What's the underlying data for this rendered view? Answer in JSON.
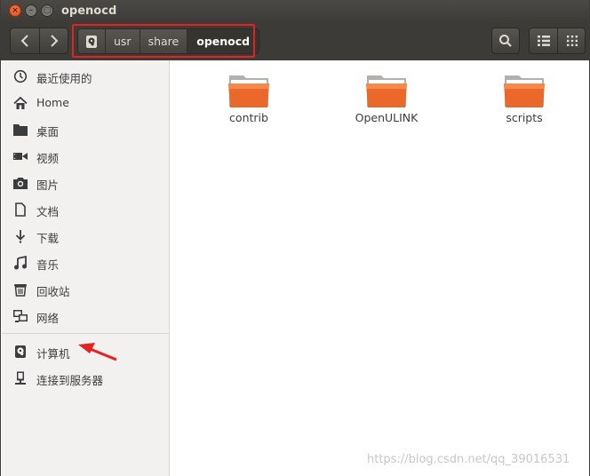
{
  "window": {
    "title": "openocd"
  },
  "titlebar": {
    "close": "×",
    "minimize": "–",
    "maximize": "□"
  },
  "breadcrumbs": [
    {
      "label": "",
      "icon": "disk-icon"
    },
    {
      "label": "usr"
    },
    {
      "label": "share"
    },
    {
      "label": "openocd",
      "active": true
    }
  ],
  "sidebar": {
    "items": [
      {
        "label": "最近使用的",
        "icon": "clock-icon"
      },
      {
        "label": "Home",
        "icon": "home-icon"
      },
      {
        "label": "桌面",
        "icon": "folder-icon"
      },
      {
        "label": "视频",
        "icon": "video-icon"
      },
      {
        "label": "图片",
        "icon": "camera-icon"
      },
      {
        "label": "文档",
        "icon": "document-icon"
      },
      {
        "label": "下载",
        "icon": "download-icon"
      },
      {
        "label": "音乐",
        "icon": "music-icon"
      },
      {
        "label": "回收站",
        "icon": "trash-icon"
      },
      {
        "label": "网络",
        "icon": "network-icon"
      }
    ],
    "devices": [
      {
        "label": "计算机",
        "icon": "disk-icon"
      },
      {
        "label": "连接到服务器",
        "icon": "server-icon"
      }
    ]
  },
  "files": [
    {
      "name": "contrib",
      "icon": "folder-icon"
    },
    {
      "name": "OpenULINK",
      "icon": "folder-icon"
    },
    {
      "name": "scripts",
      "icon": "folder-icon"
    }
  ],
  "annotation": {
    "color": "#e5221f"
  },
  "watermark": "https://blog.csdn.net/qq_39016531",
  "colors": {
    "titlebar": "#3c3b37",
    "folder": "#e9682a",
    "sidebar": "#f2f1f0"
  }
}
